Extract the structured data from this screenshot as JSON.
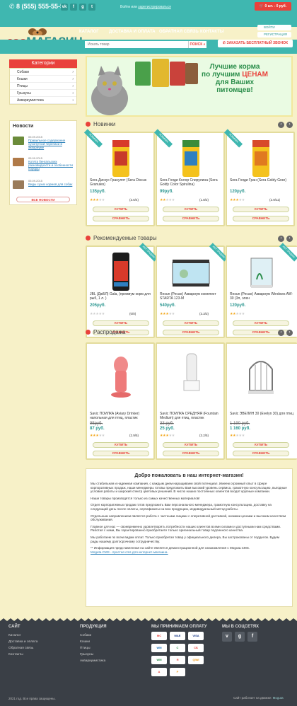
{
  "header": {
    "phone": "8 (555) 555-55-55",
    "login_text": "Войти",
    "or_text": "или",
    "register_link": "зарегистрироваться",
    "cart": "0 шт. - 0 руб.",
    "login_button": "ВОЙТИ",
    "register_button": "РЕГИСТРАЦИЯ",
    "logo_zoo": "зоо",
    "logo_shop": "МАГАЗИН",
    "nav": [
      "КАТАЛОГ",
      "ДОСТАВКА И ОПЛАТА",
      "ОБРАТНАЯ СВЯЗЬ",
      "КОНТАКТЫ"
    ],
    "search_placeholder": "Искать товар",
    "search_button": "ПОИСК",
    "call_button": "ЗАКАЗАТЬ БЕСПЛАТНЫЙ ЗВОНОК",
    "socials": [
      "vk",
      "f",
      "g+",
      "t"
    ]
  },
  "sidebar": {
    "categories_title": "Категории",
    "categories": [
      "Собаки",
      "Кошки",
      "Птицы",
      "Грызуны",
      "Аквариумистика"
    ],
    "news_title": "Новости",
    "news": [
      {
        "date": "05.09.2015",
        "title": "Правильное содержание сухопутной черепахи в аквариуме"
      },
      {
        "date": "05.09.2015",
        "title": "Котята бенгальских разновидности и особенности породы"
      },
      {
        "date": "05.09.2015",
        "title": "Виды сухих кормов для собак"
      }
    ],
    "all_news": "ВСЕ НОВОСТИ"
  },
  "banner": {
    "line1": "Лучшие корма",
    "line2_prefix": "по лучшим ",
    "line2_red": "ЦЕНАМ",
    "line3": "для Ваших",
    "line4": "питомцев!"
  },
  "sections": {
    "new": {
      "title": "Новинки",
      "items": [
        {
          "badge": "НОВИНКА",
          "name": "Sera Дискус Гранулят (Sera Discus Granules)",
          "price": "135руб.",
          "rating": 3,
          "count": "(3.6/4)"
        },
        {
          "badge": "НОВИНКА",
          "name": "Sera Голди Колор Спирулина (Sera Goldy Color Spirulina)",
          "price": "99руб.",
          "rating": 2,
          "count": "(1.8/2)"
        },
        {
          "badge": "НОВИНКА",
          "name": "Sera Голди Гран (Sera Goldy Gran)",
          "price": "120руб.",
          "rating": 3,
          "count": "(2.9/11)"
        }
      ]
    },
    "recommended": {
      "title": "Рекомендуемые товары",
      "items": [
        {
          "badge": "ХИТ ПРОДАЖ",
          "name": "JBL (ДжБЛ) Gala, (премиум корм для рыб, 1 л. )",
          "price": "205руб.",
          "rating": 0,
          "count": "(0/0)"
        },
        {
          "badge": "ХИТ ПРОДАЖ",
          "name": "Resun (Ресан) Аквариум комплект STARTA 123-M",
          "price": "540руб.",
          "rating": 3,
          "count": "(3.3/3)"
        },
        {
          "badge": "ХИТ ПРОДАЖ",
          "name": "Resun (Ресан) Аквариум Windows AW-30 (3л, элен",
          "price": "120руб.",
          "rating": 2,
          "count": ""
        }
      ]
    },
    "sale": {
      "title": "Распродажа",
      "items": [
        {
          "name": "Savic ПОИЛКА (Aviary Drinker) напольная для птиц, пластик",
          "old_price": "",
          "price": "95руб.",
          "sale_price": "87 руб.",
          "rating": 3,
          "count": "(2.9/5)"
        },
        {
          "name": "Savic ПОИЛКА СРЕДНЯЯ (Fountain Medium) для птиц, пластик",
          "old_price": "33 руб.",
          "price": "25 руб.",
          "sale_price": "",
          "rating": 3,
          "count": "(3.2/5)"
        },
        {
          "name": "Savic ЭВЕЛИН 30 (Evelyn 30) для птиц",
          "old_price": "1 190 руб.",
          "price": "1 160 руб.",
          "sale_price": "",
          "rating": 2,
          "count": ""
        }
      ]
    },
    "buy_label": "КУПИТЬ",
    "compare_label": "СРАВНИТЬ"
  },
  "welcome": {
    "title": "Добро пожаловать в наш интернет-магазин!",
    "p1": "Мы стабильная и надежная компания, с каждым днем наращиваем свой потенциал. Имеем огромный опыт в сфере корпоративных продаж, наши менеджеры готовы предложить Вам высокий уровень сервиса, грамотную консультацию, выгодные условия работы и широкий спектр цветовых решений. В число наших постоянных клиентов входят крупные компании.",
    "p2": "Наши товары производятся только из самых качественных материалов!",
    "p3": "Отдел корпоративных продаж готов предложить Вам персонального менеджера, грамотную консультацию, доставку на следующий день после оплаты, сертификаты на всю продукцию, индивидуальный метод работы.",
    "p4": "Отдельным направлением является работа с частными лицами с оперативной доставкой, низкими ценами и высоким качеством обслуживания.",
    "p5": "Главное для нас — своевременно удовлетворять потребности наших клиентов всеми силами и доступными нам средствами. Работая с нами, Вы гарантированно приобретаете только оригинальный товар подлинного качества.",
    "p6": "Мы работаем по всем видам оплат. Только приобретая товар у официального дилера, Вы застрахованы от подделок. Будем рады нашему долгосрочному сотрудничеству.",
    "p7": "** Информация представленная на сайте является демонстрационной для ознакомления с Moguta.CMS.",
    "p7_link": "Moguta.CMS - простая cms для интернет-магазина."
  },
  "footer": {
    "site_title": "САЙТ",
    "site_links": [
      "Каталог",
      "Доставка и оплата",
      "Обратная связь",
      "Контакты"
    ],
    "products_title": "ПРОДУКЦИЯ",
    "products_links": [
      "Собаки",
      "Кошки",
      "Птицы",
      "Грызуны",
      "Аквариумистика"
    ],
    "payment_title": "МЫ ПРИНИМАЕМ ОПЛАТУ",
    "payments": [
      "VISA",
      "VISA",
      "VISA",
      "WM",
      "С",
      "СБ",
      "WM",
      "Я",
      "QIWI",
      "А",
      "Р"
    ],
    "social_title": "МЫ В СОЦСЕТЯХ",
    "copyright": "2021 год. Все права защищены.",
    "credit_prefix": "Сайт работает на движке:",
    "credit_name": "Moguta"
  },
  "colors": {
    "teal": "#3fb7b0",
    "red": "#e9423b",
    "bg": "#f7f1c8"
  }
}
